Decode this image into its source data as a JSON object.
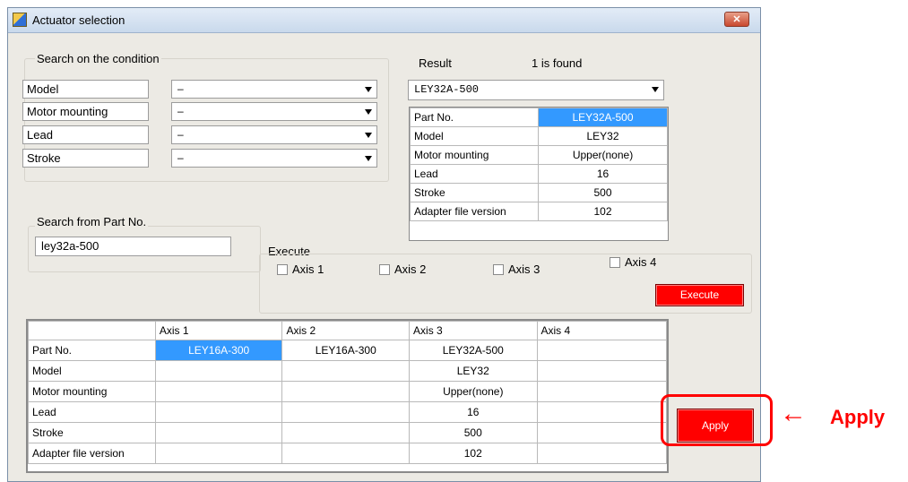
{
  "window": {
    "title": "Actuator selection",
    "close_glyph": "✕"
  },
  "condition": {
    "group_label": "Search on the condition",
    "rows": [
      {
        "label": "Model",
        "value": "–"
      },
      {
        "label": "Motor mounting",
        "value": "–"
      },
      {
        "label": "Lead",
        "value": "–"
      },
      {
        "label": "Stroke",
        "value": "–"
      }
    ]
  },
  "part_search": {
    "group_label": "Search from Part No.",
    "value": "ley32a-500"
  },
  "result": {
    "label": "Result",
    "count_text": "1 is found",
    "selected": "LEY32A-500",
    "rows": [
      {
        "key": "Part No.",
        "value": "LEY32A-500"
      },
      {
        "key": "Model",
        "value": "LEY32"
      },
      {
        "key": "Motor mounting",
        "value": "Upper(none)"
      },
      {
        "key": "Lead",
        "value": "16"
      },
      {
        "key": "Stroke",
        "value": "500"
      },
      {
        "key": "Adapter file version",
        "value": "102"
      }
    ]
  },
  "execute": {
    "group_label": "Execute",
    "axes": [
      "Axis 1",
      "Axis 2",
      "Axis 3",
      "Axis 4"
    ],
    "button": "Execute"
  },
  "axis_table": {
    "headers": [
      "",
      "Axis 1",
      "Axis 2",
      "Axis 3",
      "Axis 4"
    ],
    "rows": [
      {
        "key": "Part No.",
        "cells": [
          "LEY16A-300",
          "LEY16A-300",
          "LEY32A-500",
          ""
        ]
      },
      {
        "key": "Model",
        "cells": [
          "",
          "",
          "LEY32",
          ""
        ]
      },
      {
        "key": "Motor mounting",
        "cells": [
          "",
          "",
          "Upper(none)",
          ""
        ]
      },
      {
        "key": "Lead",
        "cells": [
          "",
          "",
          "16",
          ""
        ]
      },
      {
        "key": "Stroke",
        "cells": [
          "",
          "",
          "500",
          ""
        ]
      },
      {
        "key": "Adapter file version",
        "cells": [
          "",
          "",
          "102",
          ""
        ]
      }
    ]
  },
  "apply_button": "Apply",
  "annotation": {
    "arrow": "←",
    "text": "Apply",
    "color": "#ff0000"
  },
  "colors": {
    "selection": "#3399ff",
    "accent_red": "#ff0000"
  }
}
